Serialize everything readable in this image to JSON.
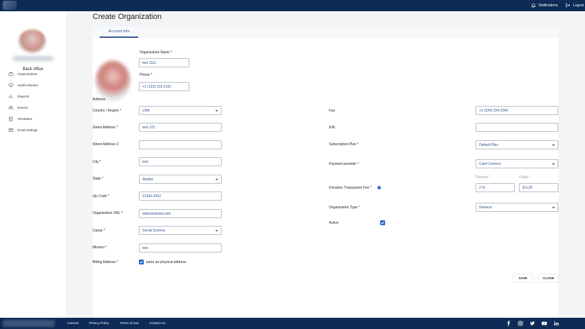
{
  "topbar": {
    "notifications_label": "Notifications",
    "logout_label": "Logout"
  },
  "sidebar": {
    "org_name": "Back office",
    "items": [
      {
        "label": "Organizations",
        "icon": "briefcase-icon"
      },
      {
        "label": "Apollo Monitor",
        "icon": "monitor-icon"
      },
      {
        "label": "Reports",
        "icon": "bar-chart-icon"
      },
      {
        "label": "Donors",
        "icon": "users-icon"
      },
      {
        "label": "Templates",
        "icon": "template-icon"
      },
      {
        "label": "Email settings",
        "icon": "mail-icon"
      }
    ]
  },
  "page": {
    "title": "Create Organization",
    "tabs": [
      {
        "label": "Account info",
        "active": true
      }
    ]
  },
  "form": {
    "org_name": {
      "label": "Organization Name *",
      "value": "test 1111"
    },
    "phone": {
      "label": "Phone *",
      "value": "+1 (123) 123-1231"
    },
    "address_section": "Address",
    "country": {
      "label": "Country / Region *",
      "value": "USA"
    },
    "street": {
      "label": "Street Address *",
      "value": "test 123"
    },
    "street2": {
      "label": "Street Address 2",
      "value": ""
    },
    "city": {
      "label": "City *",
      "value": "test"
    },
    "state": {
      "label": "State *",
      "value": "Alaska"
    },
    "zip": {
      "label": "Zip Code *",
      "value": "21341-2412"
    },
    "org_url": {
      "label": "Organization URL *",
      "value": "www.testeww.com"
    },
    "cause": {
      "label": "Cause *",
      "value": "Social Science"
    },
    "mission": {
      "label": "Mission *",
      "value": "test"
    },
    "billing": {
      "label": "Billing Address *",
      "checkbox_label": "same as physical address",
      "checked": true
    },
    "fax": {
      "label": "Fax",
      "value": "+1 (234) 234-2342"
    },
    "ein": {
      "label": "EIN",
      "value": ""
    },
    "subscription_plan": {
      "label": "Subscription Plan *",
      "value": "Default Plan"
    },
    "payment_provider": {
      "label": "Payment provider *",
      "value": "Card Connect"
    },
    "donation_fee": {
      "label": "Donation Transaction Fee *",
      "percent_label": "Percent *",
      "percent_value": "2 %",
      "dollar_label": "Dollar *",
      "dollar_value": "$ 0.20"
    },
    "org_type": {
      "label": "Organization Type *",
      "value": "General"
    },
    "active": {
      "label": "Active",
      "checked": true
    },
    "save_label": "SAVE",
    "close_label": "CLOSE"
  },
  "footer": {
    "links": [
      "Careers",
      "Privacy Policy",
      "Terms of Use",
      "Contact Us"
    ],
    "social_icons": [
      "facebook-icon",
      "instagram-icon",
      "twitter-icon",
      "youtube-icon",
      "linkedin-icon"
    ]
  },
  "colors": {
    "header_bg": "#0d2b56",
    "accent": "#2464c9",
    "input_text": "#2c4c8f"
  }
}
